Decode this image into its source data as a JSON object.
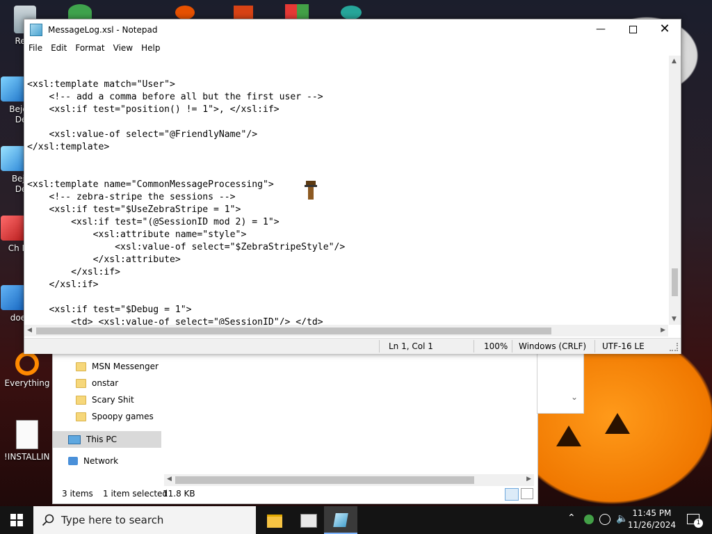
{
  "desktop": {
    "icons": [
      {
        "label": "Recy"
      },
      {
        "label": "Bejev De"
      },
      {
        "label": "Beje De"
      },
      {
        "label": "Ch De"
      },
      {
        "label": "does"
      },
      {
        "label": "Everything"
      },
      {
        "label": "!INSTALLIN..."
      }
    ]
  },
  "explorer": {
    "folders": [
      "MSN Messenger",
      "onstar",
      "Scary Shit",
      "Spoopy games"
    ],
    "this_pc": "This PC",
    "network": "Network",
    "status_items": "3 items",
    "status_selected": "1 item selected",
    "status_size": "11.8 KB"
  },
  "notepad": {
    "title": "MessageLog.xsl - Notepad",
    "menu": [
      "File",
      "Edit",
      "Format",
      "View",
      "Help"
    ],
    "code_lines": [
      "<xsl:template match=\"User\">",
      "    <!-- add a comma before all but the first user -->",
      "    <xsl:if test=\"position() != 1\">, </xsl:if>",
      "",
      "    <xsl:value-of select=\"@FriendlyName\"/>",
      "</xsl:template>",
      "",
      "",
      "<xsl:template name=\"CommonMessageProcessing\">",
      "    <!-- zebra-stripe the sessions -->",
      "    <xsl:if test=\"$UseZebraStripe = 1\">",
      "        <xsl:if test=\"(@SessionID mod 2) = 1\">",
      "            <xsl:attribute name=\"style\">",
      "                <xsl:value-of select=\"$ZebraStripeStyle\"/>",
      "            </xsl:attribute>",
      "        </xsl:if>",
      "    </xsl:if>",
      "",
      "    <xsl:if test=\"$Debug = 1\">",
      "        <td> <xsl:value-of select=\"@SessionID\"/> </td>"
    ],
    "status": {
      "position": "Ln 1, Col 1",
      "zoom": "100%",
      "line_ending": "Windows (CRLF)",
      "encoding": "UTF-16 LE"
    }
  },
  "taskbar": {
    "search_placeholder": "Type here to search",
    "time": "11:45 PM",
    "date": "11/26/2024",
    "notification_count": "1"
  }
}
